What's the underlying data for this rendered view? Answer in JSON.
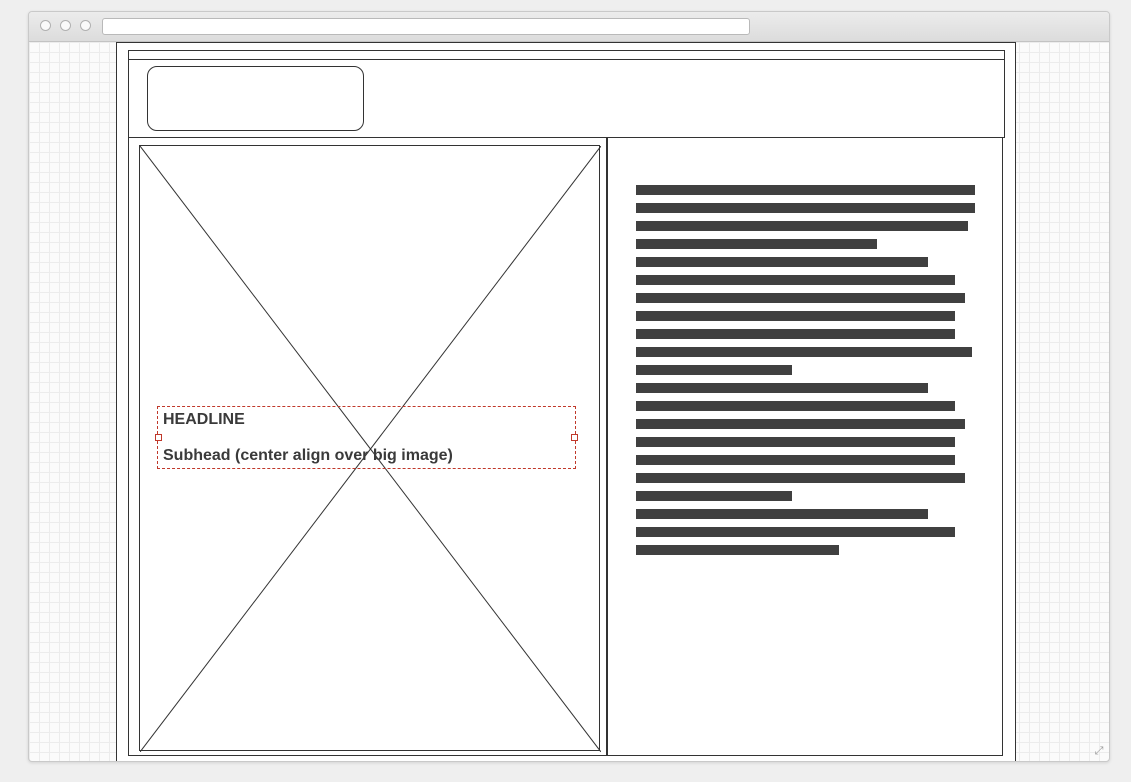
{
  "text_block": {
    "headline": "HEADLINE",
    "subhead": "Subhead (center align over big image)"
  },
  "body_text_lines": [
    {
      "fill": 1.0
    },
    {
      "fill": 1.0
    },
    {
      "fill": 0.98
    },
    {
      "fill": 0.71
    },
    {
      "fill": 0.86
    },
    {
      "fill": 0.94
    },
    {
      "fill": 0.97
    },
    {
      "fill": 0.94
    },
    {
      "fill": 0.94
    },
    {
      "fill": 0.99
    },
    {
      "fill": 0.46
    },
    {
      "fill": 0.86
    },
    {
      "fill": 0.94
    },
    {
      "fill": 0.97
    },
    {
      "fill": 0.94
    },
    {
      "fill": 0.94
    },
    {
      "fill": 0.97
    },
    {
      "fill": 0.46
    },
    {
      "fill": 0.86
    },
    {
      "fill": 0.94
    },
    {
      "fill": 0.6
    }
  ],
  "colors": {
    "wire": "#333333",
    "text_bar": "#404040",
    "selection": "#c0392b",
    "grid": "#ececec"
  },
  "icons": {
    "resize": "expand-icon"
  }
}
